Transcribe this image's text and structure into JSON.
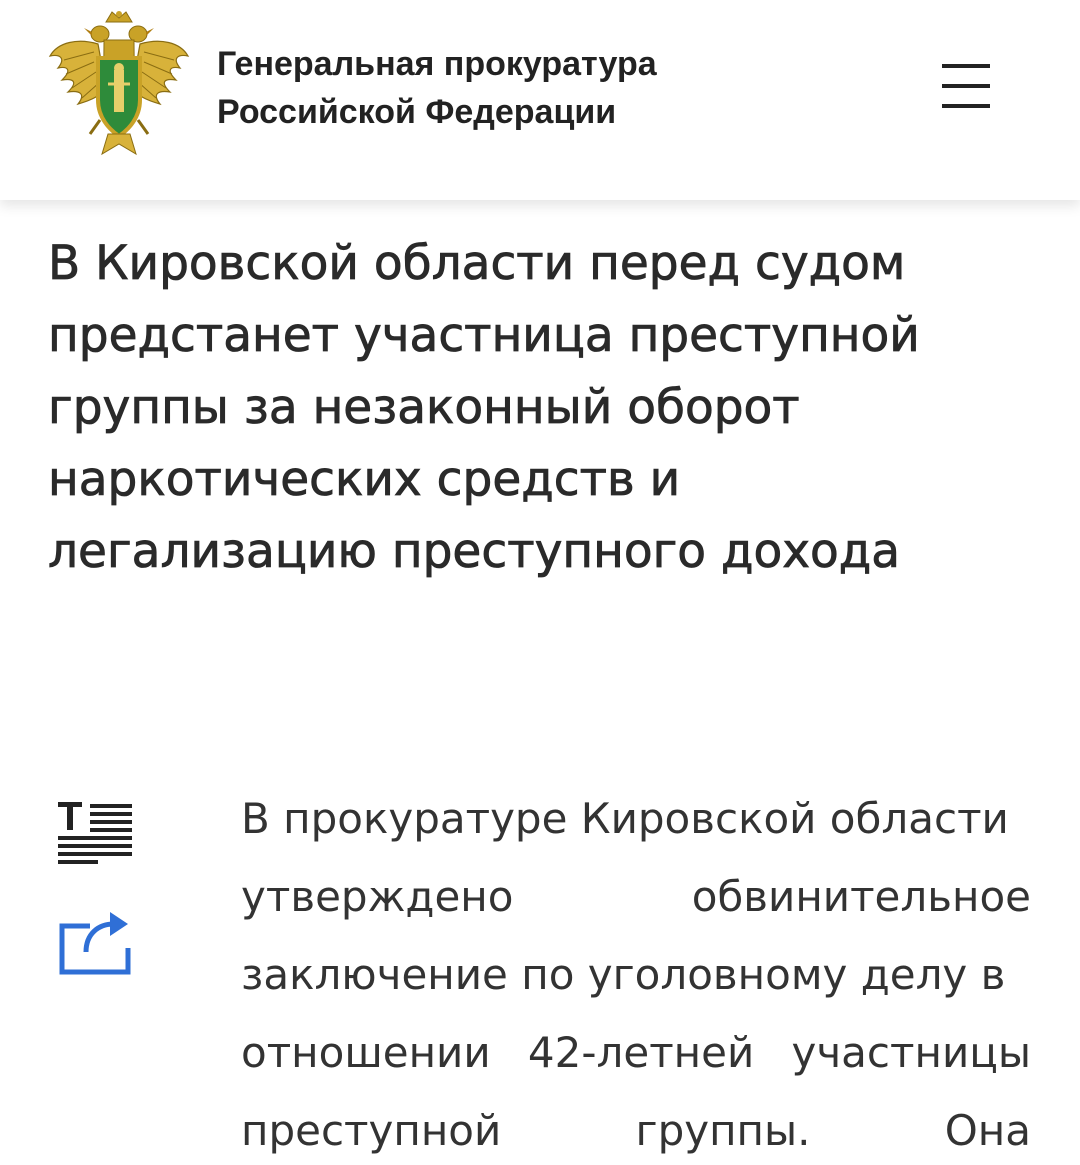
{
  "header": {
    "org_name_line1": "Генеральная прокуратура",
    "org_name_line2": "Российской Федерации",
    "emblem_icon": "prosecutor-emblem-icon",
    "menu_icon": "hamburger-menu-icon"
  },
  "article": {
    "title_lines": [
      "В Кировской области перед судом",
      "предстанет участница преступной",
      "группы за незаконный оборот",
      "наркотических средств и",
      "легализацию преступного дохода"
    ],
    "body_lines": [
      [
        "В прокуратуре Кировской области"
      ],
      [
        "утверждено",
        "обвинительное"
      ],
      [
        "заключение по уголовному делу в"
      ],
      [
        "отношении",
        "42-летней",
        "участницы"
      ],
      [
        "преступной",
        "группы.",
        "Она"
      ]
    ]
  },
  "tools": {
    "text_size_icon": "text-size-icon",
    "share_icon": "share-icon"
  },
  "colors": {
    "text": "#222222",
    "accent": "#2f6fd6",
    "emblem_gold": "#c9a227",
    "emblem_green": "#2e8b3a"
  }
}
